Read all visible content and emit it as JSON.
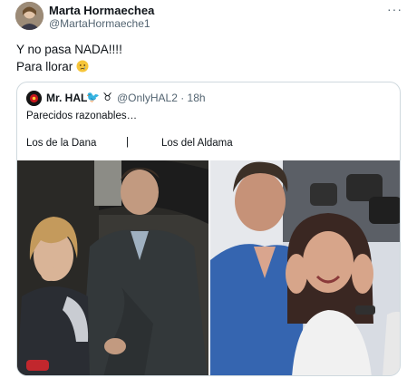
{
  "tweet": {
    "author_name": "Marta Hormaechea",
    "author_handle": "@MartaHormaeche1",
    "more_label": "···",
    "text_line1": "Y no pasa NADA!!!!",
    "text_line2": "Para llorar"
  },
  "quote": {
    "author_name": "Mr. HAL",
    "author_icons": "🐦 ♉",
    "author_handle": "@OnlyHAL2 · 18h",
    "text": "Parecidos razonables…",
    "label_left": "Los de la Dana",
    "separator": "|",
    "label_right": "Los del Aldama"
  },
  "colors": {
    "text": "#0f1419",
    "secondary": "#536471",
    "border": "#cfd9de"
  }
}
